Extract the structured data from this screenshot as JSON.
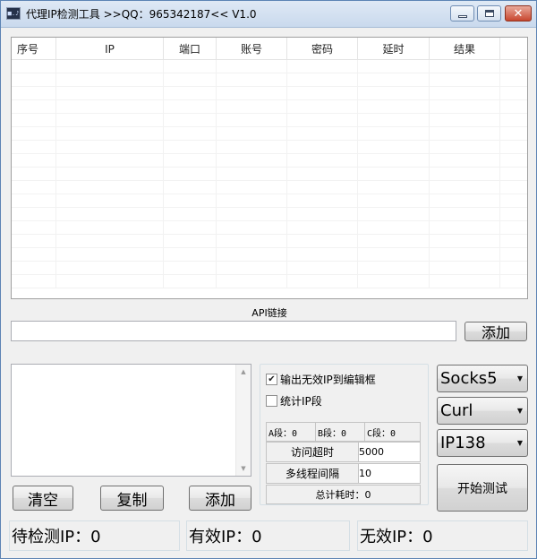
{
  "window": {
    "title": "代理IP检测工具  >>QQ：965342187<< V1.0",
    "icon": "app-icon",
    "app_icon_glyph": "■.♪",
    "controls": {
      "minimize": "minimize-icon",
      "maximize": "maximize-icon",
      "close_glyph": "✕"
    }
  },
  "grid": {
    "columns": [
      "序号",
      "IP",
      "端口",
      "账号",
      "密码",
      "延时",
      "结果"
    ],
    "rows": []
  },
  "api": {
    "label": "API链接",
    "url_value": "",
    "add_label": "添加"
  },
  "log": {
    "text": "",
    "scroll_up": "▲",
    "scroll_down": "▼"
  },
  "actions": {
    "clear_label": "清空",
    "copy_label": "复制",
    "add_label": "添加"
  },
  "options": {
    "output_invalid_label": "输出无效IP到编辑框",
    "output_invalid_checked": true,
    "check_mark": "✔",
    "stat_segment_label": "统计IP段",
    "stat_segment_checked": false,
    "segment_a": "A段：0",
    "segment_b": "B段：0",
    "segment_c": "C段：0",
    "timeout_label": "访问超时",
    "timeout_value": "5000",
    "thread_interval_label": "多线程间隔",
    "thread_interval_value": "10",
    "total_time": "总计耗时：0"
  },
  "selectors": {
    "protocol": "Socks5",
    "method": "Curl",
    "source": "IP138",
    "arrow": "▼"
  },
  "start_label": "开始测试",
  "status": {
    "pending": "待检测IP：0",
    "valid": "有效IP：0",
    "invalid": "无效IP：0"
  },
  "colors": {
    "titlebar": "#c9d9ed",
    "close_button": "#c8472f",
    "window_bg": "#f0f0f0"
  }
}
